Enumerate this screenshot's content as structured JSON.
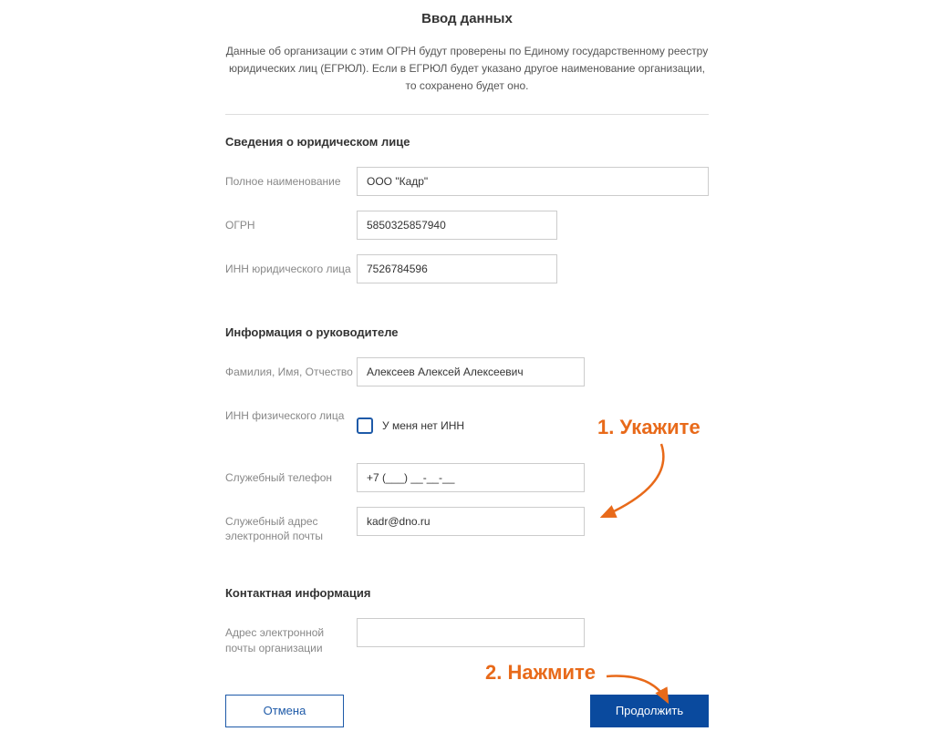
{
  "title": "Ввод данных",
  "description": "Данные об организации с этим ОГРН будут проверены по Единому государственному реестру юридических лиц (ЕГРЮЛ). Если в ЕГРЮЛ будет указано другое наименование организации, то сохранено будет оно.",
  "section1": {
    "title": "Сведения о юридическом лице",
    "full_name_label": "Полное наименование",
    "full_name_value": "ООО \"Кадр\"",
    "ogrn_label": "ОГРН",
    "ogrn_value": "5850325857940",
    "inn_label": "ИНН юридического лица",
    "inn_value": "7526784596"
  },
  "section2": {
    "title": "Информация о руководителе",
    "fio_label": "Фамилия, Имя, Отчество",
    "fio_value": "Алексеев Алексей Алексеевич",
    "inn_phys_label": "ИНН физического лица",
    "no_inn_label": "У меня нет ИНН",
    "phone_label": "Служебный телефон",
    "phone_value": "+7 (___) __-__-__",
    "email_label": "Служебный адрес электронной почты",
    "email_value": "kadr@dno.ru"
  },
  "section3": {
    "title": "Контактная информация",
    "org_email_label": "Адрес электронной почты организации",
    "org_email_value": ""
  },
  "buttons": {
    "cancel": "Отмена",
    "continue": "Продолжить"
  },
  "annotations": {
    "step1": "1. Укажите",
    "step2": "2. Нажмите"
  }
}
